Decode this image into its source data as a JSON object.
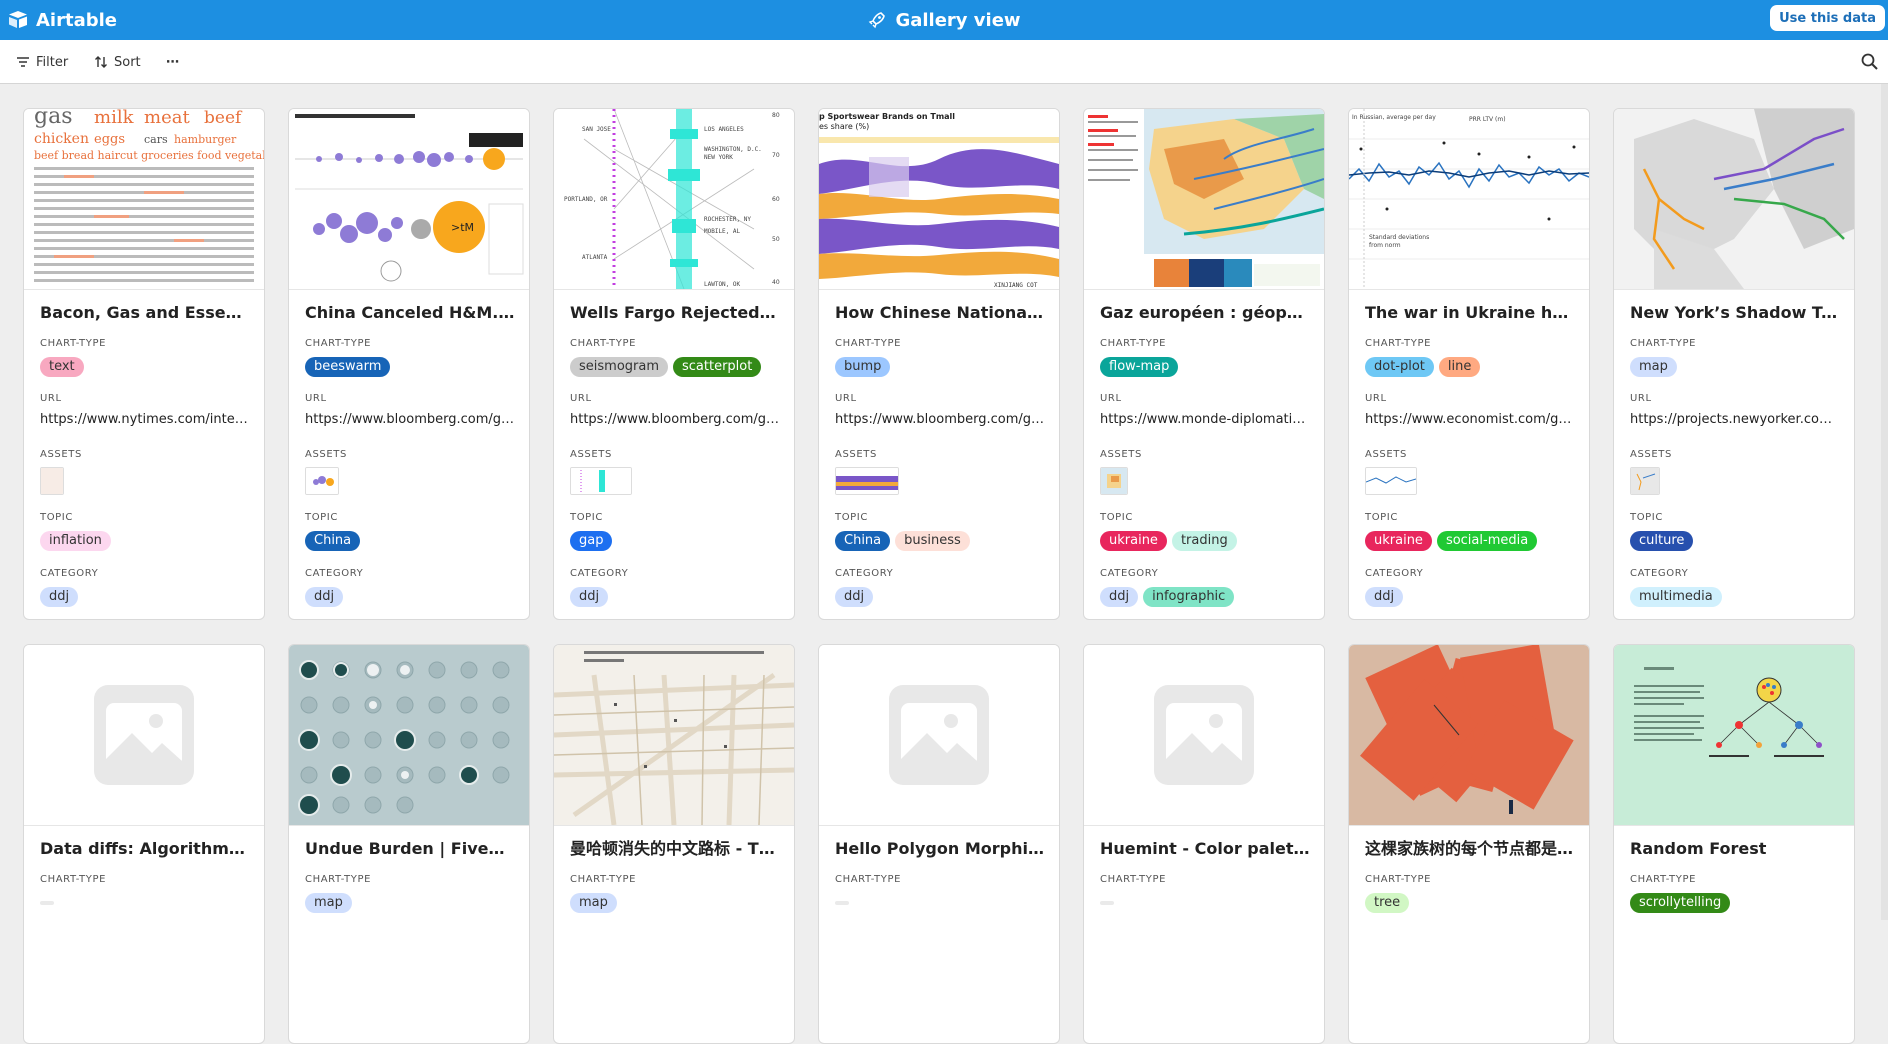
{
  "app": {
    "name": "Airtable"
  },
  "header": {
    "title": "Gallery view",
    "use_button": "Use this data"
  },
  "toolbar": {
    "filter_label": "Filter",
    "sort_label": "Sort",
    "more_label": "⋯"
  },
  "fields": {
    "chart_type": "CHART-TYPE",
    "url": "URL",
    "assets": "ASSETS",
    "topic": "TOPIC",
    "category": "CATEGORY"
  },
  "colors": {
    "header_bg": "#1d8fe1",
    "background": "#eeeeee"
  },
  "cards": [
    {
      "title": "Bacon, Gas and Essentials...",
      "chart_type": [
        {
          "label": "text",
          "bg": "#f8a8c0"
        }
      ],
      "url": "https://www.nytimes.com/intera...",
      "topic": [
        {
          "label": "inflation",
          "bg": "#fcd7ef"
        }
      ],
      "category": [
        {
          "label": "ddj",
          "bg": "#cfdefd"
        }
      ]
    },
    {
      "title": "China Canceled H&M. Eve...",
      "chart_type": [
        {
          "label": "beeswarm",
          "bg": "#1764b7",
          "fg": "#ffffff"
        }
      ],
      "url": "https://www.bloomberg.com/gra...",
      "topic": [
        {
          "label": "China",
          "bg": "#1764b7",
          "fg": "#ffffff"
        }
      ],
      "category": [
        {
          "label": "ddj",
          "bg": "#cfdefd"
        }
      ]
    },
    {
      "title": "Wells Fargo Rejected Half...",
      "chart_type": [
        {
          "label": "seismogram",
          "bg": "#cccccc"
        },
        {
          "label": "scatterplot",
          "bg": "#338a17",
          "fg": "#ffffff"
        }
      ],
      "url": "https://www.bloomberg.com/gra...",
      "topic": [
        {
          "label": "gap",
          "bg": "#1d6ff0",
          "fg": "#ffffff"
        }
      ],
      "category": [
        {
          "label": "ddj",
          "bg": "#cfdefd"
        }
      ]
    },
    {
      "title": "How Chinese Nationalism ...",
      "chart_type": [
        {
          "label": "bump",
          "bg": "#9cc7ff"
        }
      ],
      "url": "https://www.bloomberg.com/gra...",
      "topic": [
        {
          "label": "China",
          "bg": "#1764b7",
          "fg": "#ffffff"
        },
        {
          "label": "business",
          "bg": "#fde0d8"
        }
      ],
      "category": [
        {
          "label": "ddj",
          "bg": "#cfdefd"
        }
      ]
    },
    {
      "title": "Gaz européen : géopolitiq...",
      "chart_type": [
        {
          "label": "flow-map",
          "bg": "#0aa59a",
          "fg": "#ffffff"
        }
      ],
      "url": "https://www.monde-diplomatiqu...",
      "topic": [
        {
          "label": "ukraine",
          "bg": "#e8265d",
          "fg": "#ffffff"
        },
        {
          "label": "trading",
          "bg": "#c4f3e6"
        }
      ],
      "category": [
        {
          "label": "ddj",
          "bg": "#cfdefd"
        },
        {
          "label": "infographic",
          "bg": "#7fe4c6"
        }
      ]
    },
    {
      "title": "The war in Ukraine has m...",
      "chart_type": [
        {
          "label": "dot-plot",
          "bg": "#6ec8f5"
        },
        {
          "label": "line",
          "bg": "#ffa981"
        }
      ],
      "url": "https://www.economist.com/gra...",
      "topic": [
        {
          "label": "ukraine",
          "bg": "#e8265d",
          "fg": "#ffffff"
        },
        {
          "label": "social-media",
          "bg": "#20c933",
          "fg": "#ffffff"
        }
      ],
      "category": [
        {
          "label": "ddj",
          "bg": "#cfdefd"
        }
      ]
    },
    {
      "title": "New York’s Shadow Transi...",
      "chart_type": [
        {
          "label": "map",
          "bg": "#cfdefd"
        }
      ],
      "url": "https://projects.newyorker.com/...",
      "topic": [
        {
          "label": "culture",
          "bg": "#2750ae",
          "fg": "#ffffff"
        }
      ],
      "category": [
        {
          "label": "multimedia",
          "bg": "#d0f0fd"
        }
      ]
    },
    {
      "title": "Data diffs: Algorithms for...",
      "chart_type": []
    },
    {
      "title": "Undue Burden | FiveThirt...",
      "chart_type": [
        {
          "label": "map",
          "bg": "#cfdefd"
        }
      ]
    },
    {
      "title": "曼哈顿消失的中文路标 - Th...",
      "chart_type": [
        {
          "label": "map",
          "bg": "#cfdefd"
        }
      ]
    },
    {
      "title": "Hello Polygon Morphing /...",
      "chart_type": []
    },
    {
      "title": "Huemint - Color palette g...",
      "chart_type": []
    },
    {
      "title": "这棵家族树的每个节点都是...",
      "chart_type": [
        {
          "label": "tree",
          "bg": "#d1f7c4"
        }
      ]
    },
    {
      "title": "Random Forest",
      "chart_type": [
        {
          "label": "scrollytelling",
          "bg": "#338a17",
          "fg": "#ffffff"
        }
      ]
    }
  ]
}
